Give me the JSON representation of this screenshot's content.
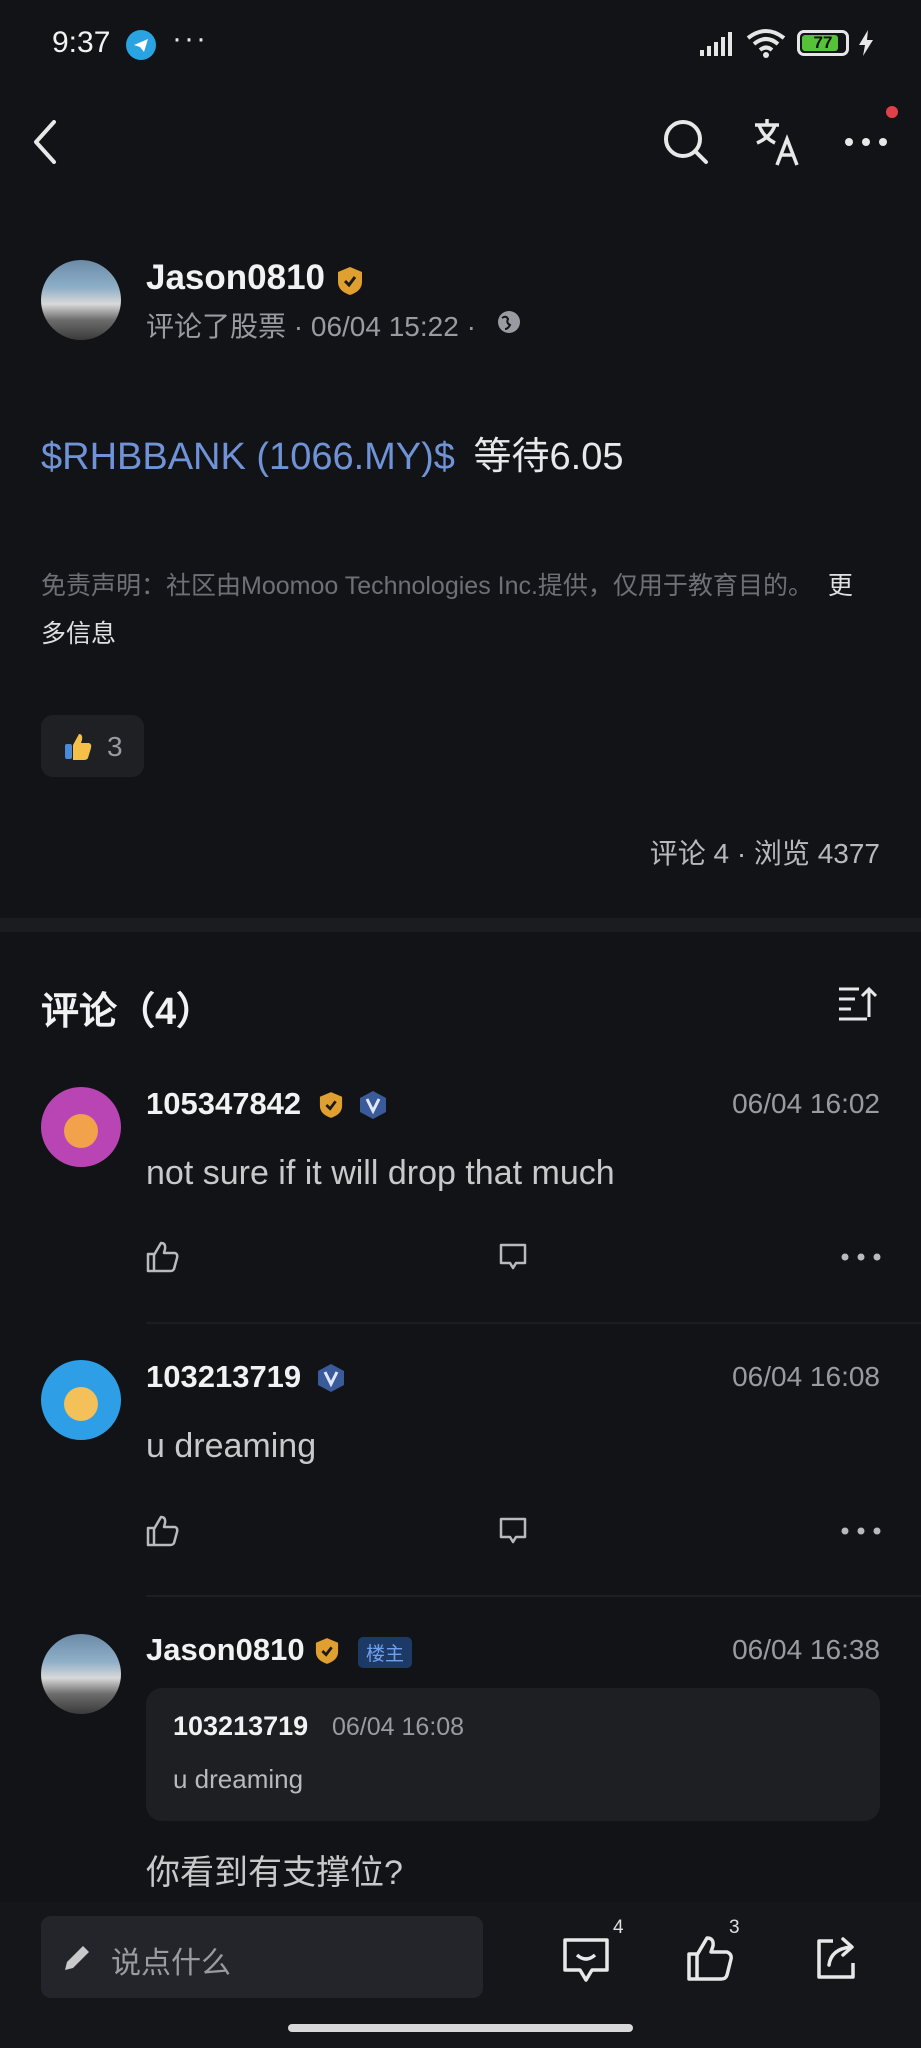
{
  "status_bar": {
    "time": "9:37",
    "more": "···",
    "battery": "77"
  },
  "nav": {
    "back": "back-icon",
    "search": "search-icon",
    "translate": "translate-icon",
    "more": "more-icon"
  },
  "post": {
    "author": "Jason0810",
    "meta": "评论了股票 · 06/04 15:22 ·",
    "stock_link": "$RHBBANK (1066.MY)$",
    "text": "等待6.05",
    "disclaimer": "免责声明：社区由Moomoo Technologies Inc.提供，仅用于教育目的。",
    "more_info": "更多信息",
    "like_count": "3",
    "stats": "评论 4 · 浏览 4377"
  },
  "comments_section": {
    "title": "评论（4）",
    "items": [
      {
        "user": "105347842",
        "time": "06/04 16:02",
        "text": "not sure if it will drop that much"
      },
      {
        "user": "103213719",
        "time": "06/04 16:08",
        "text": "u dreaming"
      },
      {
        "user": "Jason0810",
        "owner_tag": "楼主",
        "time": "06/04 16:38",
        "quote_user": "103213719",
        "quote_time": "06/04 16:08",
        "quote_text": "u dreaming",
        "text": "你看到有支撑位?"
      }
    ]
  },
  "bottom_bar": {
    "input_placeholder": "说点什么",
    "comment_count": "4",
    "like_count": "3"
  },
  "colors": {
    "background": "#121316",
    "link": "#6f93d6",
    "badge_gold": "#e0a030",
    "notify_dot": "#e0404a"
  }
}
